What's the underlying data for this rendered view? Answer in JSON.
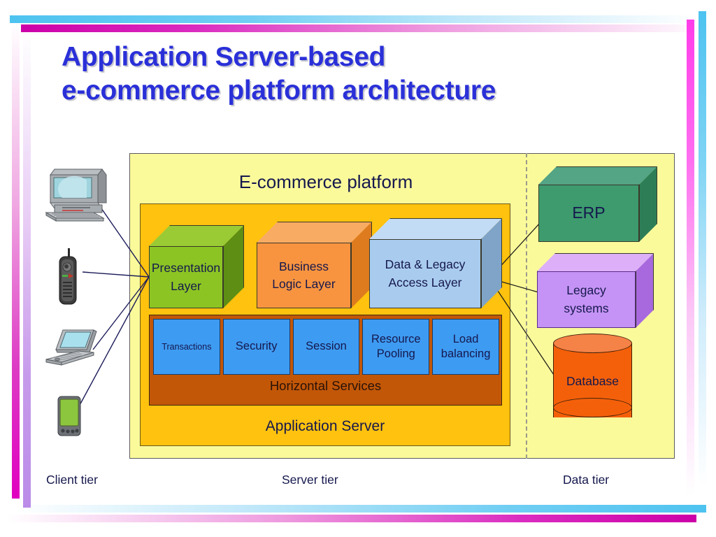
{
  "title": {
    "line1": "Application Server-based",
    "line2": "e-commerce platform architecture",
    "color": "#2A30D8"
  },
  "platform": {
    "heading": "E-commerce platform",
    "app_server_label": "Application Server"
  },
  "layers": [
    {
      "name": "presentation",
      "line1": "Presentation",
      "line2": "Layer",
      "color": "#8CC523"
    },
    {
      "name": "business",
      "line1": "Business",
      "line2": "Logic Layer",
      "color": "#F89440"
    },
    {
      "name": "data-access",
      "line1": "Data & Legacy",
      "line2": "Access Layer",
      "color": "#A9CCEE"
    }
  ],
  "horizontal_services": {
    "label": "Horizontal Services",
    "color": "#C25708",
    "cells": [
      {
        "line1": "Transactions",
        "line2": ""
      },
      {
        "line1": "Security",
        "line2": ""
      },
      {
        "line1": "Session",
        "line2": ""
      },
      {
        "line1": "Resource",
        "line2": "Pooling"
      },
      {
        "line1": "Load",
        "line2": "balancing"
      }
    ]
  },
  "data_tier": {
    "erp": {
      "label": "ERP",
      "color": "#3D9B6E"
    },
    "legacy": {
      "line1": "Legacy",
      "line2": "systems",
      "color": "#C593F5"
    },
    "database": {
      "label": "Database",
      "color": "#F4600A"
    }
  },
  "tiers": {
    "client": "Client tier",
    "server": "Server tier",
    "data": "Data tier"
  },
  "client_devices": [
    {
      "name": "desktop-computer-icon"
    },
    {
      "name": "mobile-phone-icon"
    },
    {
      "name": "laptop-icon"
    },
    {
      "name": "pda-icon"
    }
  ]
}
